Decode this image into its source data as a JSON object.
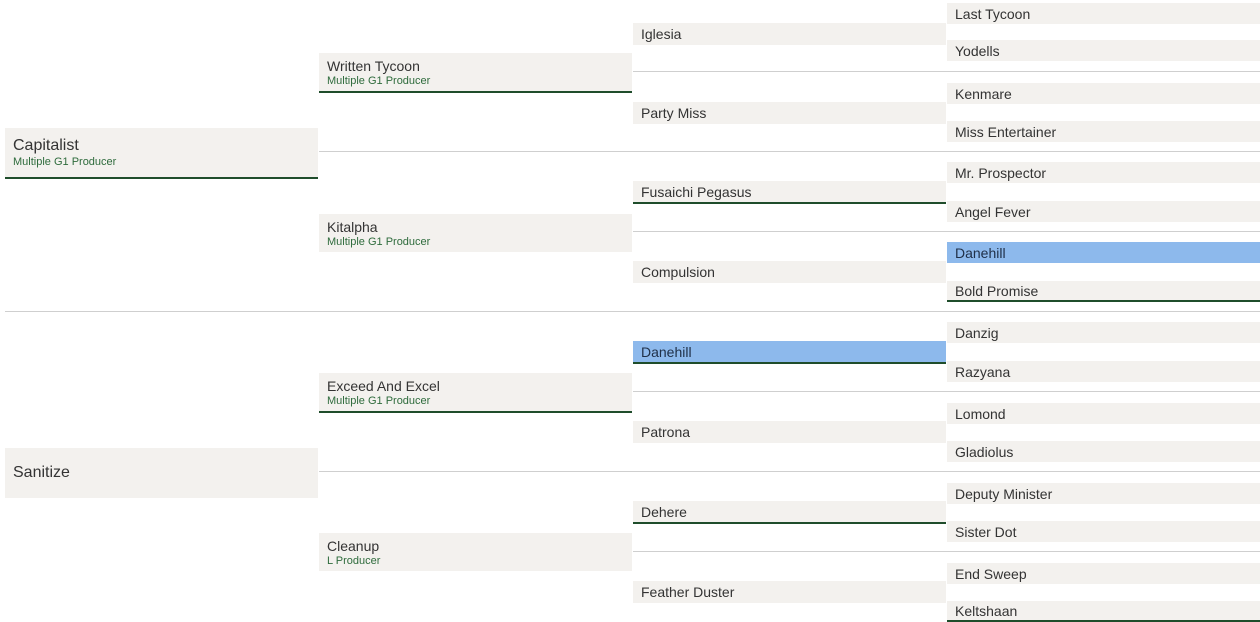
{
  "colors": {
    "cell_background": "#f3f1ee",
    "status_text": "#2e6b3c",
    "underline": "#1f4d2b",
    "highlight": "#8db9ec"
  },
  "sire": {
    "name": "Capitalist",
    "status": "Multiple G1 Producer",
    "sire": {
      "name": "Written Tycoon",
      "status": "Multiple G1 Producer",
      "sire": {
        "name": "Iglesia",
        "sire": {
          "name": "Last Tycoon"
        },
        "dam": {
          "name": "Yodells"
        }
      },
      "dam": {
        "name": "Party Miss",
        "sire": {
          "name": "Kenmare"
        },
        "dam": {
          "name": "Miss Entertainer"
        }
      }
    },
    "dam": {
      "name": "Kitalpha",
      "status": "Multiple G1 Producer",
      "sire": {
        "name": "Fusaichi Pegasus",
        "sire": {
          "name": "Mr. Prospector"
        },
        "dam": {
          "name": "Angel Fever"
        }
      },
      "dam": {
        "name": "Compulsion",
        "sire": {
          "name": "Danehill",
          "highlighted": true
        },
        "dam": {
          "name": "Bold Promise"
        }
      }
    }
  },
  "dam": {
    "name": "Sanitize",
    "sire": {
      "name": "Exceed And Excel",
      "status": "Multiple G1 Producer",
      "sire": {
        "name": "Danehill",
        "highlighted": true,
        "sire": {
          "name": "Danzig"
        },
        "dam": {
          "name": "Razyana"
        }
      },
      "dam": {
        "name": "Patrona",
        "sire": {
          "name": "Lomond"
        },
        "dam": {
          "name": "Gladiolus"
        }
      }
    },
    "dam": {
      "name": "Cleanup",
      "status": "L Producer",
      "sire": {
        "name": "Dehere",
        "sire": {
          "name": "Deputy Minister"
        },
        "dam": {
          "name": "Sister Dot"
        }
      },
      "dam": {
        "name": "Feather Duster",
        "sire": {
          "name": "End Sweep"
        },
        "dam": {
          "name": "Keltshaan"
        }
      }
    }
  }
}
